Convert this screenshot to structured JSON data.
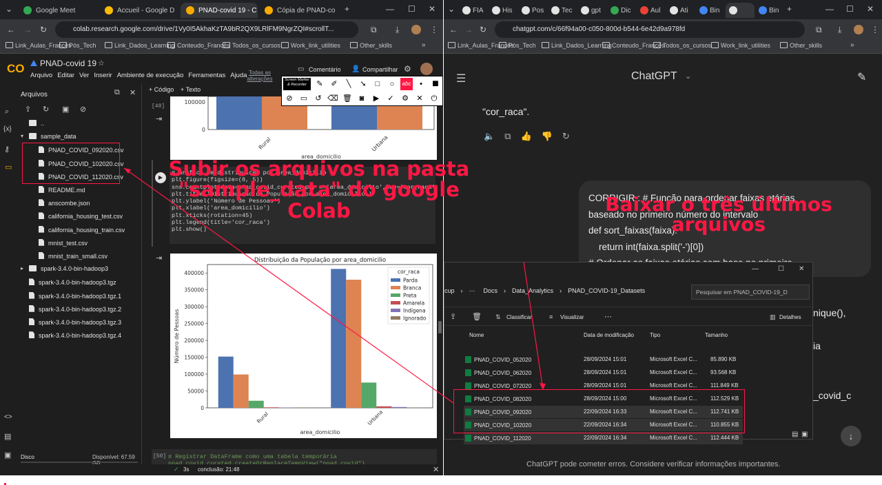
{
  "left_browser": {
    "tabs": [
      {
        "label": "Google Meet",
        "color": "#34a853"
      },
      {
        "label": "Accueil - Google D",
        "color": "#fbbc04"
      },
      {
        "label": "PNAD-covid 19 - C",
        "color": "#f9ab00"
      },
      {
        "label": "Cópia de PNAD-co",
        "color": "#f9ab00"
      }
    ],
    "url": "colab.research.google.com/drive/1Vy0I5AkhaKzTA9bR2QX9LRlFM9NgrZQI#scrollT...",
    "bookmarks": [
      "Link_Aulas_Francês",
      "Pós_Tech",
      "Link_Dados_Learning",
      "Conteudo_Francês",
      "Todos_os_cursos",
      "Work_link_utilities",
      "Other_skills"
    ]
  },
  "right_browser": {
    "tabs": [
      "FIA",
      "His",
      "Pos",
      "Tec",
      "gpt",
      "Dic",
      "Aul",
      "Ati",
      "Bin",
      "",
      "Bin"
    ],
    "url": "chatgpt.com/c/66f94a00-c050-800d-b544-6e42d9a978fd",
    "bookmarks": [
      "Link_Aulas_Francês",
      "Pós_Tech",
      "Link_Dados_Learning",
      "Conteudo_Francês",
      "Todos_os_cursos",
      "Work_link_utilities",
      "Other_skills"
    ]
  },
  "colab": {
    "logo": "CO",
    "title": "PNAD-covid 19",
    "menu": [
      "Arquivo",
      "Editar",
      "Ver",
      "Inserir",
      "Ambiente de execução",
      "Ferramentas",
      "Ajuda"
    ],
    "all_changes": "Todas as alterações",
    "comment": "Comentário",
    "share": "Compartilhar",
    "add_code": "+ Código",
    "add_text": "+ Texto",
    "files_title": "Arquivos",
    "files": [
      {
        "name": "..",
        "type": "folder",
        "indent": 0
      },
      {
        "name": "sample_data",
        "type": "folder",
        "indent": 0
      },
      {
        "name": "PNAD_COVID_092020.csv",
        "type": "file",
        "indent": 1
      },
      {
        "name": "PNAD_COVID_102020.csv",
        "type": "file",
        "indent": 1
      },
      {
        "name": "PNAD_COVID_112020.csv",
        "type": "file",
        "indent": 1
      },
      {
        "name": "README.md",
        "type": "file",
        "indent": 1
      },
      {
        "name": "anscombe.json",
        "type": "file",
        "indent": 1
      },
      {
        "name": "california_housing_test.csv",
        "type": "file",
        "indent": 1
      },
      {
        "name": "california_housing_train.csv",
        "type": "file",
        "indent": 1
      },
      {
        "name": "mnist_test.csv",
        "type": "file",
        "indent": 1
      },
      {
        "name": "mnist_train_small.csv",
        "type": "file",
        "indent": 1
      },
      {
        "name": "spark-3.4.0-bin-hadoop3",
        "type": "folder",
        "indent": 0
      },
      {
        "name": "spark-3.4.0-bin-hadoop3.tgz",
        "type": "file",
        "indent": 0
      },
      {
        "name": "spark-3.4.0-bin-hadoop3.tgz.1",
        "type": "file",
        "indent": 0
      },
      {
        "name": "spark-3.4.0-bin-hadoop3.tgz.2",
        "type": "file",
        "indent": 0
      },
      {
        "name": "spark-3.4.0-bin-hadoop3.tgz.3",
        "type": "file",
        "indent": 0
      },
      {
        "name": "spark-3.4.0-bin-hadoop3.tgz.4",
        "type": "file",
        "indent": 0
      }
    ],
    "disk_label": "Disco",
    "disk_available": "Disponível: 67.59 GB",
    "cell_48": "[48]",
    "cell_code": "# Gráfico de distribuição por area_domicilio\nplt.figure(figsize=(8, 5))\nsns.countplot(data=pnad_covid_curated_pd, x='area_domicilio',hue='cor_raca',order=\nplt.title('Distribuição da População por area_domicilio')\nplt.ylabel('Número de Pessoas')\nplt.xlabel('area_domicilio')\nplt.xticks(rotation=45)\nplt.legend(title='cor_raca')\nplt.show()",
    "cell_50": "[50]",
    "cell50_code": "# Registrar DataFrame como uma tabela temporária\npnad_covid_curated.createOrReplaceTempView(\"pnad_covid\")",
    "status_time": "3s",
    "status_done": "conclusão: 21:48"
  },
  "chart_data": [
    {
      "type": "bar",
      "categories": [
        "Rural",
        "Urbana"
      ],
      "xlabel": "area_domicilio",
      "ylabel": "",
      "ylim": [
        0,
        130000
      ],
      "yticks": [
        0,
        100000
      ],
      "series": [
        {
          "name": "Branca",
          "color": "#dd8452",
          "values": [
            100000,
            100000
          ]
        },
        {
          "color": "#4c72b0",
          "values": [
            100000,
            100000
          ]
        }
      ]
    },
    {
      "type": "bar",
      "title": "Distribuição da População por area_domicilio",
      "xlabel": "area_domicilio",
      "ylabel": "Número de Pessoas",
      "categories": [
        "Rural",
        "Urbana"
      ],
      "ylim": [
        0,
        425000
      ],
      "yticks": [
        0,
        50000,
        100000,
        150000,
        200000,
        250000,
        300000,
        350000,
        400000
      ],
      "legend_title": "cor_raca",
      "legend_position": "top-right",
      "series": [
        {
          "name": "Parda",
          "color": "#4c72b0",
          "values": [
            152000,
            412000
          ]
        },
        {
          "name": "Branca",
          "color": "#dd8452",
          "values": [
            99000,
            380000
          ]
        },
        {
          "name": "Preta",
          "color": "#55a868",
          "values": [
            21000,
            75000
          ]
        },
        {
          "name": "Amarela",
          "color": "#c44e52",
          "values": [
            1500,
            4500
          ]
        },
        {
          "name": "Indígena",
          "color": "#8172b3",
          "values": [
            1000,
            2500
          ]
        },
        {
          "name": "Ignorado",
          "color": "#937860",
          "values": [
            300,
            500
          ]
        }
      ]
    }
  ],
  "chatgpt": {
    "title": "ChatGPT",
    "snippet1": "\"cor_raca\".",
    "code_lines": [
      "CORRIGIR : # Função para ordenar faixas etárias",
      "baseado no primeiro número do intervalo",
      "def sort_faixas(faixa):",
      "    return int(faixa.split('-')[0])",
      "# Ordenar as faixas etárias com base no primeiro"
    ],
    "side_frag1": "nique(),",
    "side_frag2": "ia",
    "side_frag3": "_covid_c",
    "footer": "ChatGPT pode cometer erros. Considere verificar informações importantes."
  },
  "explorer": {
    "breadcrumb": [
      "cup",
      "Docs",
      "Data_Analytics",
      "PNAD_COVID-19_Datasets"
    ],
    "search_placeholder": "Pesquisar em PNAD_COVID-19_D",
    "sort": "Classificar",
    "view": "Visualizar",
    "details": "Detalhes",
    "columns": [
      "Nome",
      "Data de modificação",
      "Tipo",
      "Tamanho"
    ],
    "rows": [
      {
        "name": "PNAD_COVID_052020",
        "date": "28/09/2024 15:01",
        "type": "Microsoft Excel C...",
        "size": "85.890 KB"
      },
      {
        "name": "PNAD_COVID_062020",
        "date": "28/09/2024 15:01",
        "type": "Microsoft Excel C...",
        "size": "93.568 KB"
      },
      {
        "name": "PNAD_COVID_072020",
        "date": "28/09/2024 15:01",
        "type": "Microsoft Excel C...",
        "size": "111.849 KB"
      },
      {
        "name": "PNAD_COVID_082020",
        "date": "28/09/2024 15:00",
        "type": "Microsoft Excel C...",
        "size": "112.529 KB"
      },
      {
        "name": "PNAD_COVID_092020",
        "date": "22/09/2024 16:33",
        "type": "Microsoft Excel C...",
        "size": "112.741 KB"
      },
      {
        "name": "PNAD_COVID_102020",
        "date": "22/09/2024 16:34",
        "type": "Microsoft Excel C...",
        "size": "110.855 KB"
      },
      {
        "name": "PNAD_COVID_112020",
        "date": "22/09/2024 16:34",
        "type": "Microsoft Excel C...",
        "size": "112.444 KB"
      }
    ]
  },
  "annotations": {
    "left_text": "Subir os arquivos na pasta \"sample_data\" do google Colab",
    "right_text": "Baixar o três últimos arquivos",
    "color": "#ff1744"
  },
  "screen_marker": {
    "label": "Screen Marker & Recorder"
  }
}
